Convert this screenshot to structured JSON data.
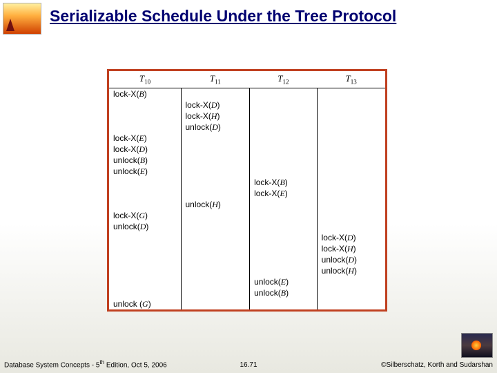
{
  "title": "Serializable Schedule Under the Tree Protocol",
  "columns": [
    {
      "name": "T",
      "sub": "10"
    },
    {
      "name": "T",
      "sub": "11"
    },
    {
      "name": "T",
      "sub": "12"
    },
    {
      "name": "T",
      "sub": "13"
    }
  ],
  "rows": [
    {
      "c0": "lock-X(B)",
      "c1": "",
      "c2": "",
      "c3": ""
    },
    {
      "c0": "",
      "c1": "lock-X(D)",
      "c2": "",
      "c3": ""
    },
    {
      "c0": "",
      "c1": "lock-X(H)",
      "c2": "",
      "c3": ""
    },
    {
      "c0": "",
      "c1": "unlock(D)",
      "c2": "",
      "c3": ""
    },
    {
      "c0": "lock-X(E)",
      "c1": "",
      "c2": "",
      "c3": ""
    },
    {
      "c0": "lock-X(D)",
      "c1": "",
      "c2": "",
      "c3": ""
    },
    {
      "c0": "unlock(B)",
      "c1": "",
      "c2": "",
      "c3": ""
    },
    {
      "c0": "unlock(E)",
      "c1": "",
      "c2": "",
      "c3": ""
    },
    {
      "c0": "",
      "c1": "",
      "c2": "lock-X(B)",
      "c3": ""
    },
    {
      "c0": "",
      "c1": "",
      "c2": "lock-X(E)",
      "c3": ""
    },
    {
      "c0": "",
      "c1": "unlock(H)",
      "c2": "",
      "c3": ""
    },
    {
      "c0": "lock-X(G)",
      "c1": "",
      "c2": "",
      "c3": ""
    },
    {
      "c0": "unlock(D)",
      "c1": "",
      "c2": "",
      "c3": ""
    },
    {
      "c0": "",
      "c1": "",
      "c2": "",
      "c3": "lock-X(D)"
    },
    {
      "c0": "",
      "c1": "",
      "c2": "",
      "c3": "lock-X(H)"
    },
    {
      "c0": "",
      "c1": "",
      "c2": "",
      "c3": "unlock(D)"
    },
    {
      "c0": "",
      "c1": "",
      "c2": "",
      "c3": "unlock(H)"
    },
    {
      "c0": "",
      "c1": "",
      "c2": "unlock(E)",
      "c3": ""
    },
    {
      "c0": "",
      "c1": "",
      "c2": "unlock(B)",
      "c3": ""
    },
    {
      "c0": "unlock  (G)",
      "c1": "",
      "c2": "",
      "c3": ""
    }
  ],
  "footer": {
    "left_a": "Database System Concepts - 5",
    "left_sup": "th",
    "left_b": " Edition, Oct 5, 2006",
    "center": "16.71",
    "right": "©Silberschatz, Korth and Sudarshan"
  }
}
